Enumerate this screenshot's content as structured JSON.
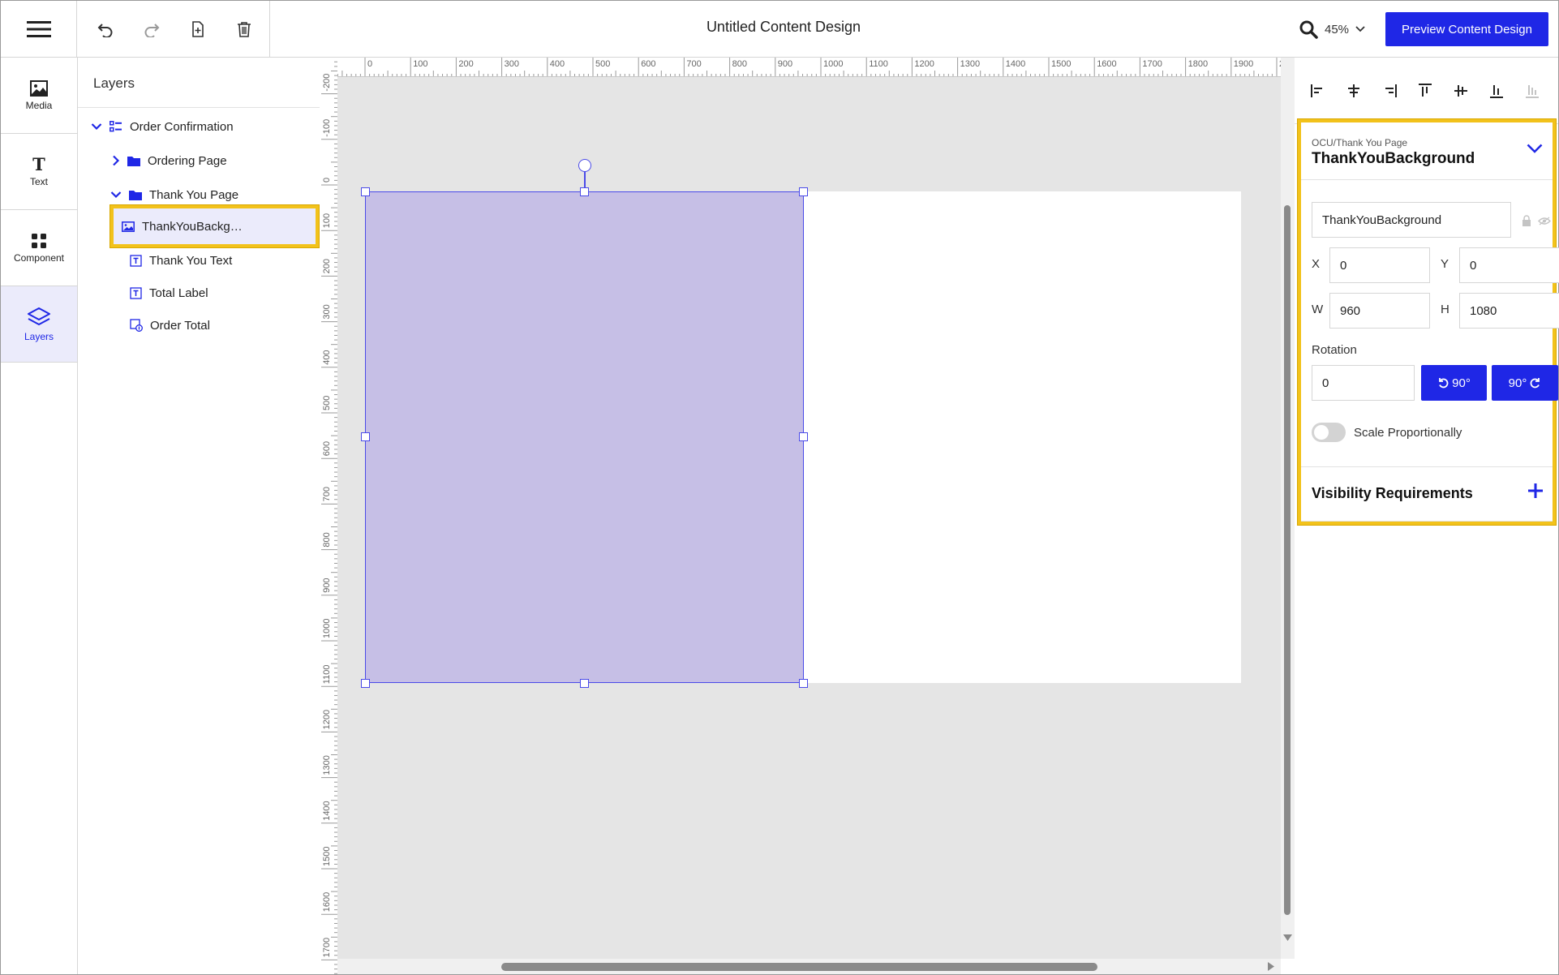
{
  "header": {
    "title": "Untitled Content Design",
    "zoom": "45%",
    "preview_label": "Preview Content Design",
    "tools": [
      "undo-icon",
      "redo-icon",
      "new-page-icon",
      "trash-icon"
    ]
  },
  "rail": {
    "items": [
      {
        "label": "Media",
        "icon": "image-icon"
      },
      {
        "label": "Text",
        "icon": "text-icon"
      },
      {
        "label": "Component",
        "icon": "component-grid-icon"
      },
      {
        "label": "Layers",
        "icon": "layers-icon",
        "active": true
      }
    ]
  },
  "layers": {
    "title": "Layers",
    "rows": [
      {
        "label": "Order Confirmation",
        "icon": "component-icon",
        "expanded": true
      },
      {
        "label": "Ordering Page",
        "icon": "folder-icon",
        "expanded": false
      },
      {
        "label": "Thank You Page",
        "icon": "folder-icon",
        "expanded": true
      },
      {
        "label": "ThankYouBackg…",
        "icon": "image-layer-icon",
        "selected": true
      },
      {
        "label": "Thank You Text",
        "icon": "text-layer-icon"
      },
      {
        "label": "Total Label",
        "icon": "text-layer-icon"
      },
      {
        "label": "Order Total",
        "icon": "dynamic-value-icon"
      }
    ]
  },
  "rulers": {
    "horizontal": [
      "0",
      "100",
      "200",
      "300",
      "400",
      "500",
      "600",
      "700",
      "800",
      "900",
      "1000",
      "1100",
      "1200",
      "1300",
      "1400",
      "1500",
      "1600",
      "1700",
      "1800",
      "1900",
      "200"
    ],
    "vertical": [
      "-200",
      "-100",
      "0",
      "100",
      "200",
      "300",
      "400",
      "500",
      "600",
      "700",
      "800",
      "900",
      "1000",
      "1100",
      "1200",
      "1300",
      "1400",
      "1500",
      "1600",
      "1700"
    ]
  },
  "properties": {
    "align_tools": [
      "align-left-icon",
      "align-center-h-icon",
      "align-right-icon",
      "align-top-icon",
      "align-middle-v-icon",
      "align-bottom-icon",
      "distribute-icon"
    ],
    "path": "OCU/Thank You Page",
    "name": "ThankYouBackground",
    "name_field": "ThankYouBackground",
    "x_label": "X",
    "x_value": "0",
    "y_label": "Y",
    "y_value": "0",
    "w_label": "W",
    "w_value": "960",
    "h_label": "H",
    "h_value": "1080",
    "rotation_label": "Rotation",
    "rotation_value": "0",
    "rotate_ccw_label": "90°",
    "rotate_cw_label": "90°",
    "scale_label": "Scale Proportionally",
    "scale_on": false,
    "visibility_title": "Visibility Requirements"
  },
  "colors": {
    "accent": "#1f27e6",
    "highlight": "#f2c21b",
    "selection_fill": "#c6bfe6"
  }
}
